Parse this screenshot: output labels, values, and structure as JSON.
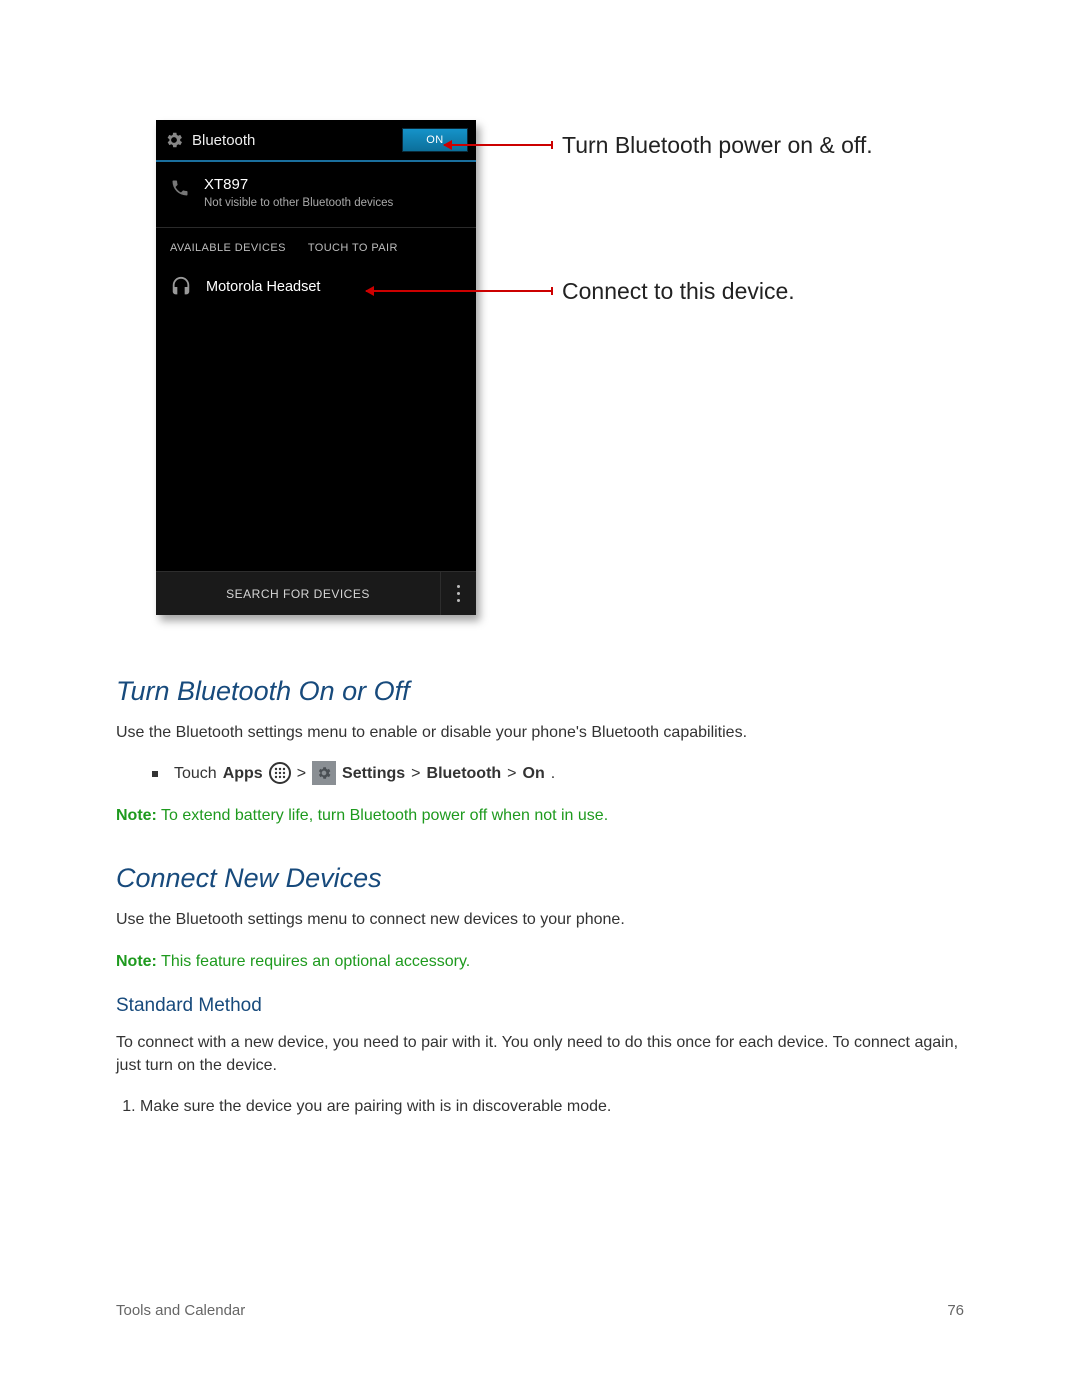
{
  "screenshot": {
    "header_title": "Bluetooth",
    "toggle_label": "ON",
    "self_device": {
      "name": "XT897",
      "subtitle": "Not visible to other Bluetooth devices"
    },
    "available_label": "AVAILABLE DEVICES",
    "touch_to_pair_label": "TOUCH TO PAIR",
    "paired_device_name": "Motorola Headset",
    "search_label": "SEARCH FOR DEVICES"
  },
  "annotations": {
    "toggle": "Turn Bluetooth power on & off.",
    "connect": "Connect to this device."
  },
  "section1": {
    "title": "Turn Bluetooth On or Off",
    "intro": "Use the Bluetooth settings menu to enable or disable your phone's Bluetooth capabilities.",
    "bullet": {
      "touch": "Touch ",
      "apps": "Apps",
      "settings": " Settings",
      "bluetooth": "Bluetooth",
      "on": "On",
      "gt": " > ",
      "period": "."
    },
    "note_label": "Note:",
    "note_text": " To extend battery life, turn Bluetooth power off when not in use."
  },
  "section2": {
    "title": "Connect New Devices",
    "intro": "Use the Bluetooth settings menu to connect new devices to your phone.",
    "note_label": "Note:",
    "note_text": " This feature requires an optional accessory.",
    "sub_title": "Standard Method",
    "para": "To connect with a new device, you need to pair with it. You only need to do this once for each device. To connect again, just turn on the device.",
    "step1": "Make sure the device you are pairing with is in discoverable mode."
  },
  "footer": {
    "left": "Tools and Calendar",
    "right": "76"
  }
}
